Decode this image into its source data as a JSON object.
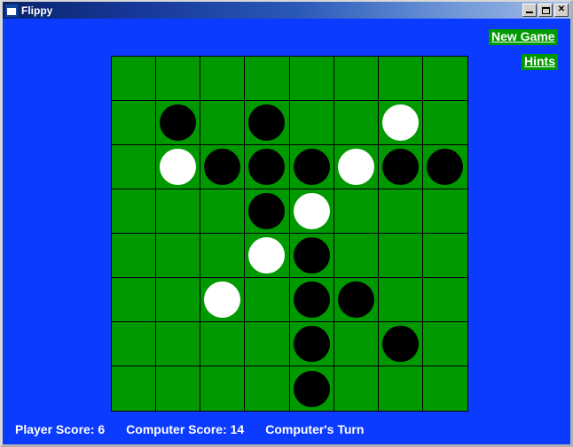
{
  "window": {
    "title": "Flippy",
    "icon": "window-icon",
    "background_color": "#0A3BFF",
    "controls": [
      {
        "name": "minimize",
        "label": "_"
      },
      {
        "name": "maximize",
        "label": "□"
      },
      {
        "name": "close",
        "label": "✕"
      }
    ]
  },
  "menu": {
    "new_game_label": "New Game",
    "hints_label": "Hints",
    "button_color": "#009900",
    "text_color": "#FFFFFF"
  },
  "board": {
    "rows": 8,
    "cols": 8,
    "cell_color": "#009900",
    "grid_line_color": "#000000",
    "black_color": "#000000",
    "white_color": "#FFFFFF",
    "tiles": [
      [
        "empty",
        "empty",
        "empty",
        "empty",
        "empty",
        "empty",
        "empty",
        "empty"
      ],
      [
        "empty",
        "black",
        "empty",
        "black",
        "empty",
        "empty",
        "white",
        "empty"
      ],
      [
        "empty",
        "white",
        "black",
        "black",
        "black",
        "white",
        "black",
        "black"
      ],
      [
        "empty",
        "empty",
        "empty",
        "black",
        "white",
        "empty",
        "empty",
        "empty"
      ],
      [
        "empty",
        "empty",
        "empty",
        "white",
        "black",
        "empty",
        "empty",
        "empty"
      ],
      [
        "empty",
        "empty",
        "white",
        "empty",
        "black",
        "black",
        "empty",
        "empty"
      ],
      [
        "empty",
        "empty",
        "empty",
        "empty",
        "black",
        "empty",
        "black",
        "empty"
      ],
      [
        "empty",
        "empty",
        "empty",
        "empty",
        "black",
        "empty",
        "empty",
        "empty"
      ]
    ]
  },
  "status": {
    "player_score": "Player Score: 6",
    "computer_score": "Computer Score: 14",
    "turn": "Computer's Turn"
  }
}
